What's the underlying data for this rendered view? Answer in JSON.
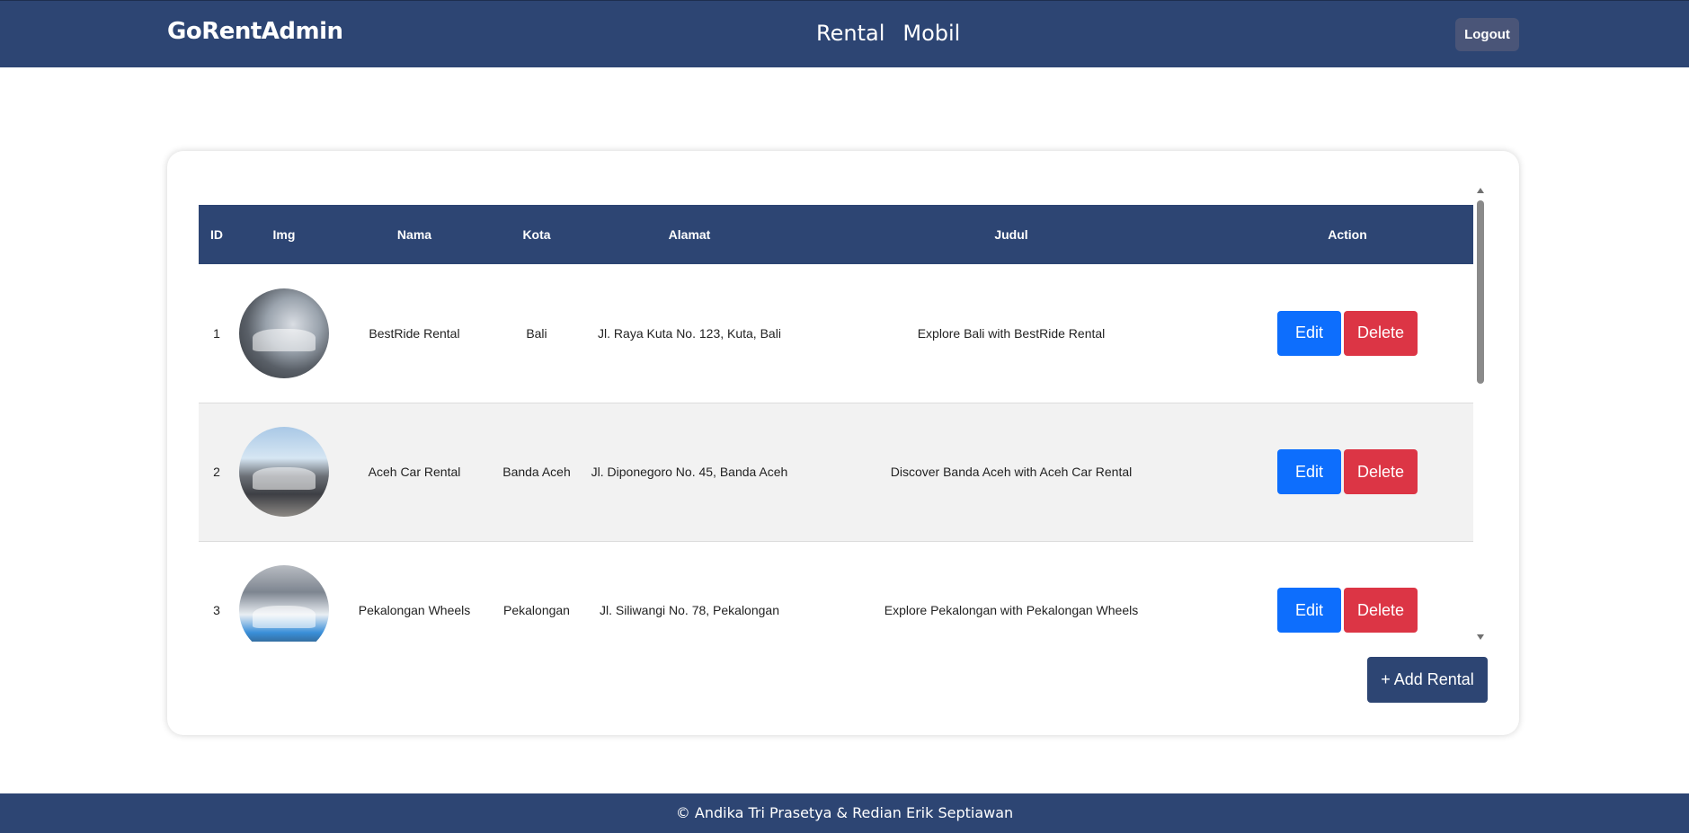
{
  "header": {
    "brand": "GoRentAdmin",
    "nav": [
      "Rental",
      "Mobil"
    ],
    "logout_label": "Logout"
  },
  "table": {
    "columns": [
      "ID",
      "Img",
      "Nama",
      "Kota",
      "Alamat",
      "Judul",
      "Action"
    ],
    "rows": [
      {
        "id": "1",
        "nama": "BestRide Rental",
        "kota": "Bali",
        "alamat": "Jl. Raya Kuta No. 123, Kuta, Bali",
        "judul": "Explore Bali with BestRide Rental"
      },
      {
        "id": "2",
        "nama": "Aceh Car Rental",
        "kota": "Banda Aceh",
        "alamat": "Jl. Diponegoro No. 45, Banda Aceh",
        "judul": "Discover Banda Aceh with Aceh Car Rental"
      },
      {
        "id": "3",
        "nama": "Pekalongan Wheels",
        "kota": "Pekalongan",
        "alamat": "Jl. Siliwangi No. 78, Pekalongan",
        "judul": "Explore Pekalongan with Pekalongan Wheels"
      }
    ],
    "edit_label": "Edit",
    "delete_label": "Delete"
  },
  "add_button_label": "+ Add Rental",
  "footer": {
    "text": "© Andika Tri Prasetya & Redian Erik Septiawan"
  },
  "colors": {
    "primary": "#2d4573",
    "edit": "#0d6efd",
    "delete": "#dc3545"
  }
}
